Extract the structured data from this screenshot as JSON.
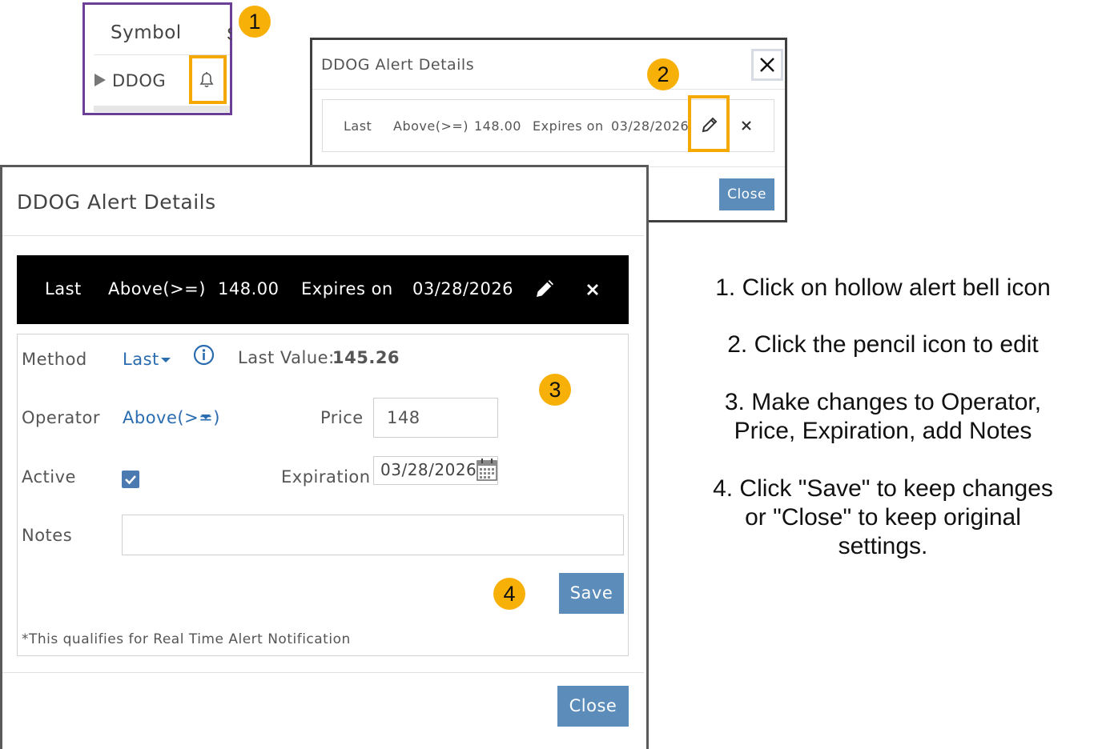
{
  "symbol_panel": {
    "header": "Symbol",
    "symbol": "DDOG",
    "icon": "bell-outline-icon"
  },
  "callouts": [
    "1",
    "2",
    "3",
    "4"
  ],
  "small_dialog": {
    "title": "DDOG Alert Details",
    "row": {
      "method": "Last",
      "operator": "Above(>=)",
      "price": "148.00",
      "expires_label": "Expires on",
      "expires_date": "03/28/2026"
    },
    "close_label": "Close"
  },
  "big_dialog": {
    "title": "DDOG Alert Details",
    "bar": {
      "method": "Last",
      "operator": "Above(>=)",
      "price": "148.00",
      "expires_label": "Expires on",
      "expires_date": "03/28/2026"
    },
    "form": {
      "method_label": "Method",
      "method_value": "Last",
      "last_value_label": "Last Value:",
      "last_value": "145.26",
      "operator_label": "Operator",
      "operator_value": "Above(>=)",
      "price_label": "Price",
      "price_value": "148",
      "active_label": "Active",
      "active_checked": true,
      "expiration_label": "Expiration",
      "expiration_value": "03/28/2026",
      "notes_label": "Notes",
      "notes_value": "",
      "save_label": "Save",
      "footnote": "*This qualifies for Real Time Alert Notification"
    },
    "close_label": "Close"
  },
  "instructions": {
    "step1": "1. Click on hollow alert bell icon",
    "step2": "2.  Click the pencil icon to edit",
    "step3_line1": "3. Make changes to Operator,",
    "step3_line2": "Price, Expiration, add Notes",
    "step4_line1": "4. Click \"Save\" to keep changes",
    "step4_line2": "or \"Close\" to keep original",
    "step4_line3": "settings."
  },
  "colors": {
    "highlight": "#f5a800",
    "callout": "#f7b008",
    "purple_frame": "#6b3f95",
    "button": "#5c8cb9",
    "link": "#2a6cb0"
  }
}
